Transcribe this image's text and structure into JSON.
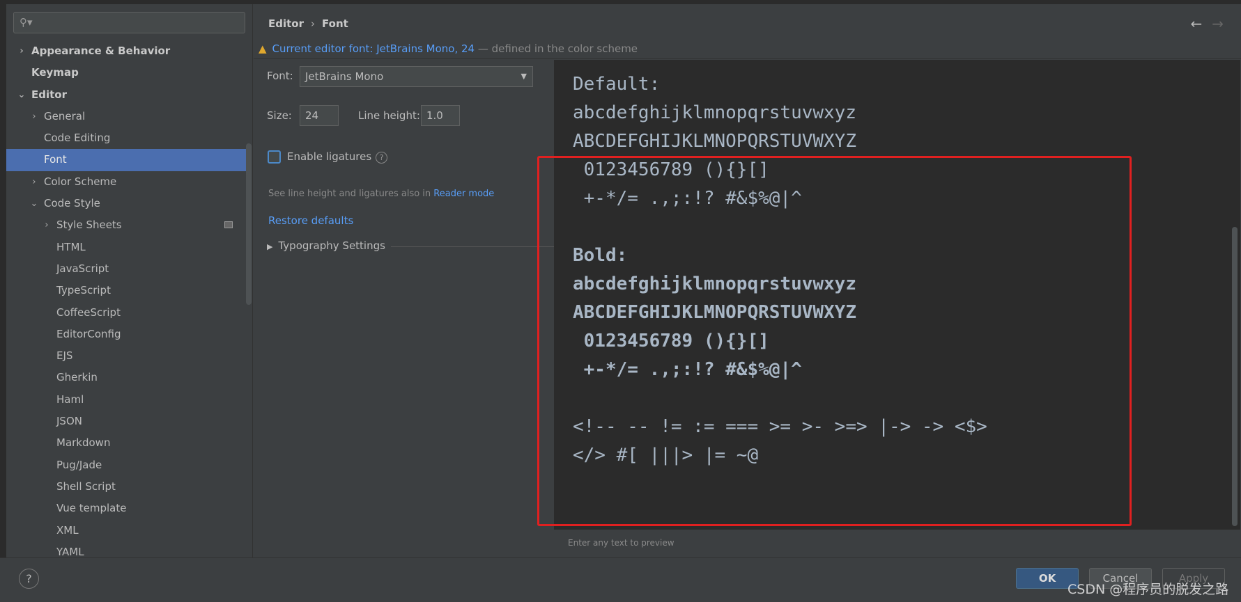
{
  "search": {
    "placeholder": ""
  },
  "sidebar": {
    "items": [
      {
        "label": "Appearance & Behavior",
        "level": 0,
        "arrow": "›",
        "bold": true
      },
      {
        "label": "Keymap",
        "level": 0,
        "arrow": "",
        "bold": true
      },
      {
        "label": "Editor",
        "level": 0,
        "arrow": "⌄",
        "bold": true
      },
      {
        "label": "General",
        "level": 1,
        "arrow": "›"
      },
      {
        "label": "Code Editing",
        "level": 1,
        "arrow": ""
      },
      {
        "label": "Font",
        "level": 1,
        "arrow": "",
        "selected": true
      },
      {
        "label": "Color Scheme",
        "level": 1,
        "arrow": "›"
      },
      {
        "label": "Code Style",
        "level": 1,
        "arrow": "⌄"
      },
      {
        "label": "Style Sheets",
        "level": 2,
        "arrow": "›",
        "icon": true
      },
      {
        "label": "HTML",
        "level": 2,
        "arrow": ""
      },
      {
        "label": "JavaScript",
        "level": 2,
        "arrow": ""
      },
      {
        "label": "TypeScript",
        "level": 2,
        "arrow": ""
      },
      {
        "label": "CoffeeScript",
        "level": 2,
        "arrow": ""
      },
      {
        "label": "EditorConfig",
        "level": 2,
        "arrow": ""
      },
      {
        "label": "EJS",
        "level": 2,
        "arrow": ""
      },
      {
        "label": "Gherkin",
        "level": 2,
        "arrow": ""
      },
      {
        "label": "Haml",
        "level": 2,
        "arrow": ""
      },
      {
        "label": "JSON",
        "level": 2,
        "arrow": ""
      },
      {
        "label": "Markdown",
        "level": 2,
        "arrow": ""
      },
      {
        "label": "Pug/Jade",
        "level": 2,
        "arrow": ""
      },
      {
        "label": "Shell Script",
        "level": 2,
        "arrow": ""
      },
      {
        "label": "Vue template",
        "level": 2,
        "arrow": ""
      },
      {
        "label": "XML",
        "level": 2,
        "arrow": ""
      },
      {
        "label": "YAML",
        "level": 2,
        "arrow": ""
      }
    ]
  },
  "header": {
    "crumb1": "Editor",
    "sep": "›",
    "crumb2": "Font",
    "back": "←",
    "forward": "→"
  },
  "warning": {
    "link": "Current editor font: JetBrains Mono, 24",
    "rest": " — defined in the color scheme"
  },
  "form": {
    "font_label": "Font:",
    "font_value": "JetBrains Mono",
    "size_label": "Size:",
    "size_value": "24",
    "lh_label": "Line height:",
    "lh_value": "1.0",
    "ligatures_label": "Enable ligatures",
    "ligatures_checked": false,
    "note": "See line height and ligatures also in ",
    "note_link": "Reader mode",
    "restore": "Restore defaults",
    "typography": "Typography Settings"
  },
  "preview": {
    "lines": [
      "Default:",
      "abcdefghijklmnopqrstuvwxyz",
      "ABCDEFGHIJKLMNOPQRSTUVWXYZ",
      " 0123456789 (){}[]",
      " +-*/= .,;:!? #&$%@|^",
      "",
      "Bold:",
      "abcdefghijklmnopqrstuvwxyz",
      "ABCDEFGHIJKLMNOPQRSTUVWXYZ",
      " 0123456789 (){}[]",
      " +-*/= .,;:!? #&$%@|^",
      "",
      "<!-- -- != := === >= >- >=> |-> -> <$>",
      "</> #[ |||> |= ~@"
    ],
    "bold_from": 6,
    "bold_to": 10,
    "hint": "Enter any text to preview"
  },
  "footer": {
    "help": "?",
    "ok": "OK",
    "cancel": "Cancel",
    "apply": "Apply"
  },
  "watermark": "CSDN @程序员的脱发之路"
}
